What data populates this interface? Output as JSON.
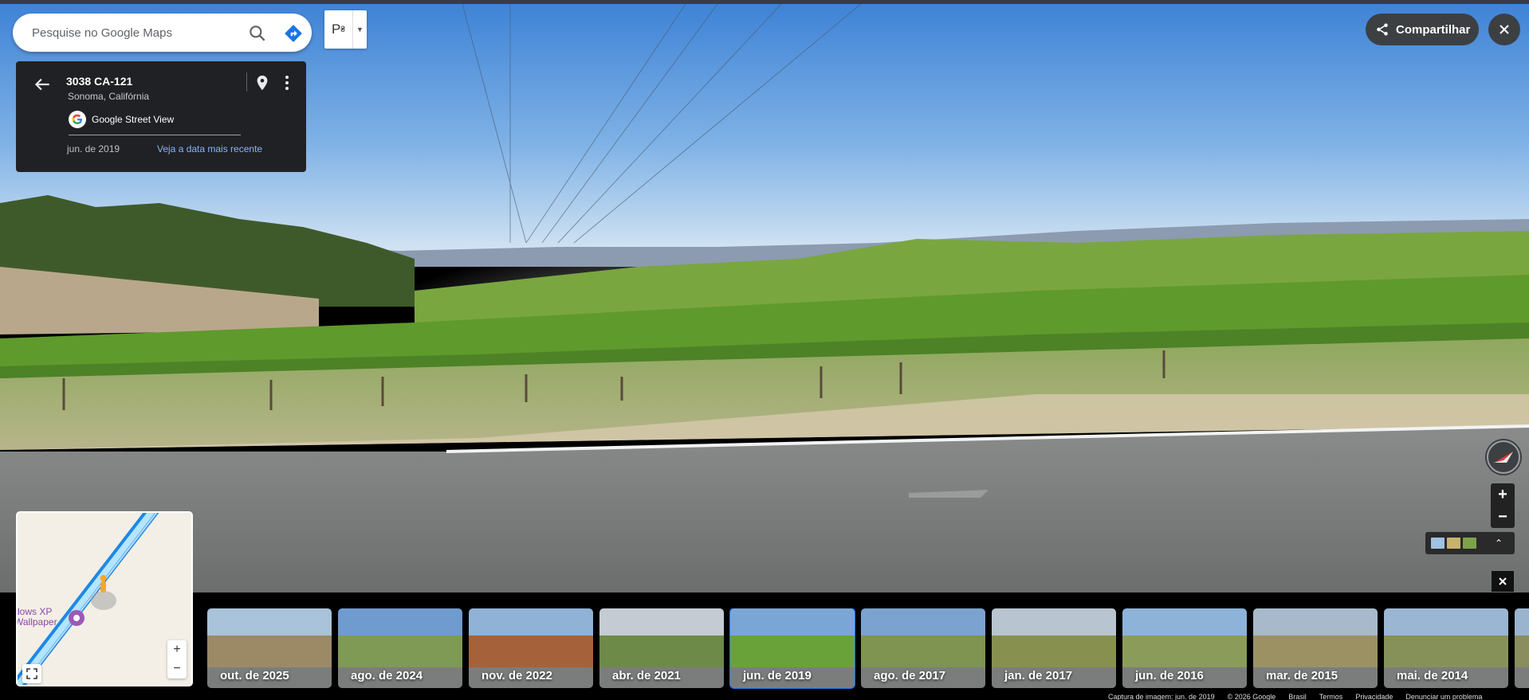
{
  "search": {
    "placeholder": "Pesquise no Google Maps"
  },
  "info_panel": {
    "title": "3038 CA-121",
    "subtitle": "Sonoma, Califórnia",
    "provider": "Google Street View",
    "date": "jun. de 2019",
    "latest_link": "Veja a data mais recente"
  },
  "top_right": {
    "share_label": "Compartilhar"
  },
  "minimap": {
    "poi_label": "dows XP\nWallpaper",
    "zoom_in": "+",
    "zoom_out": "−"
  },
  "zoom": {
    "in": "+",
    "out": "−"
  },
  "timeline": {
    "selected": "jun. de 2019",
    "items": [
      {
        "label": "out. de 2025",
        "sky": "#a9c3da",
        "land": "#9c8a66"
      },
      {
        "label": "ago. de 2024",
        "sky": "#6f9bcf",
        "land": "#7e9a55"
      },
      {
        "label": "nov. de 2022",
        "sky": "#8fb2d6",
        "land": "#a5623a"
      },
      {
        "label": "abr. de 2021",
        "sky": "#c4cbd2",
        "land": "#6d8a49"
      },
      {
        "label": "jun. de 2019",
        "sky": "#7aa6d6",
        "land": "#6aa23a"
      },
      {
        "label": "ago. de 2017",
        "sky": "#7ca3cf",
        "land": "#7e9450"
      },
      {
        "label": "jan. de 2017",
        "sky": "#b8c4cf",
        "land": "#87904f"
      },
      {
        "label": "jun. de 2016",
        "sky": "#8db3d9",
        "land": "#8b9c5a"
      },
      {
        "label": "mar. de 2015",
        "sky": "#a7b9cb",
        "land": "#9c9163"
      },
      {
        "label": "mai. de 2014",
        "sky": "#9bb6d2",
        "land": "#86915a"
      },
      {
        "label": "",
        "sky": "#9ab4cf",
        "land": "#8a8d5e"
      }
    ]
  },
  "footer": {
    "capture": "Captura de imagem: jun. de 2019",
    "copyright": "© 2026 Google",
    "country": "Brasil",
    "terms": "Termos",
    "privacy": "Privacidade",
    "report": "Denunciar um problema"
  },
  "colors": {
    "accent": "#1a73e8",
    "panel_bg": "#202124",
    "link": "#8ab4f8",
    "vine_green": "#5f9a2c",
    "sky_blue": "#4f8fd8"
  }
}
